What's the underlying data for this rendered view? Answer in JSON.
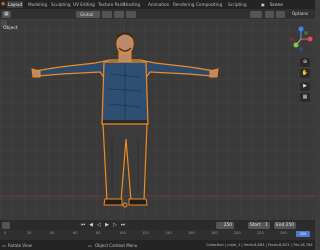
{
  "workspace_tabs": [
    {
      "label": "Layout",
      "active": true
    },
    {
      "label": "Modeling",
      "active": false
    },
    {
      "label": "Sculpting",
      "active": false
    },
    {
      "label": "UV Editing",
      "active": false
    },
    {
      "label": "Texture Paint",
      "active": false
    },
    {
      "label": "Shading",
      "active": false
    },
    {
      "label": "Animation",
      "active": false
    },
    {
      "label": "Rendering",
      "active": false
    },
    {
      "label": "Compositing",
      "active": false
    },
    {
      "label": "Scripting",
      "active": false
    }
  ],
  "scene_selector": {
    "label": "Scene"
  },
  "header": {
    "orientation": "Global",
    "options_label": "Options"
  },
  "viewport": {
    "mode_label": "Object"
  },
  "gizmo": {
    "axes": [
      {
        "name": "X",
        "color": "#e04a5a"
      },
      {
        "name": "Y",
        "color": "#8bc34a"
      },
      {
        "name": "Z",
        "color": "#4a84e0"
      }
    ]
  },
  "timeline": {
    "current_frame": "250",
    "start_label": "Start",
    "start_value": "1",
    "end_label": "End",
    "end_value": "250",
    "ruler_ticks": [
      "0",
      "20",
      "40",
      "60",
      "80",
      "100",
      "120",
      "140",
      "160",
      "180",
      "200",
      "220",
      "240"
    ],
    "current_marker": "250"
  },
  "status_bar": {
    "left": "Rotate View",
    "middle": "Object Context Menu",
    "right": "Collection | male_1 | Verts:8,683 | Faces:8,623 | Tris:16,784"
  },
  "colors": {
    "selection_outline": "#f08a24",
    "shirt": "#2c4a6b",
    "pants": "#3a3a3a"
  }
}
